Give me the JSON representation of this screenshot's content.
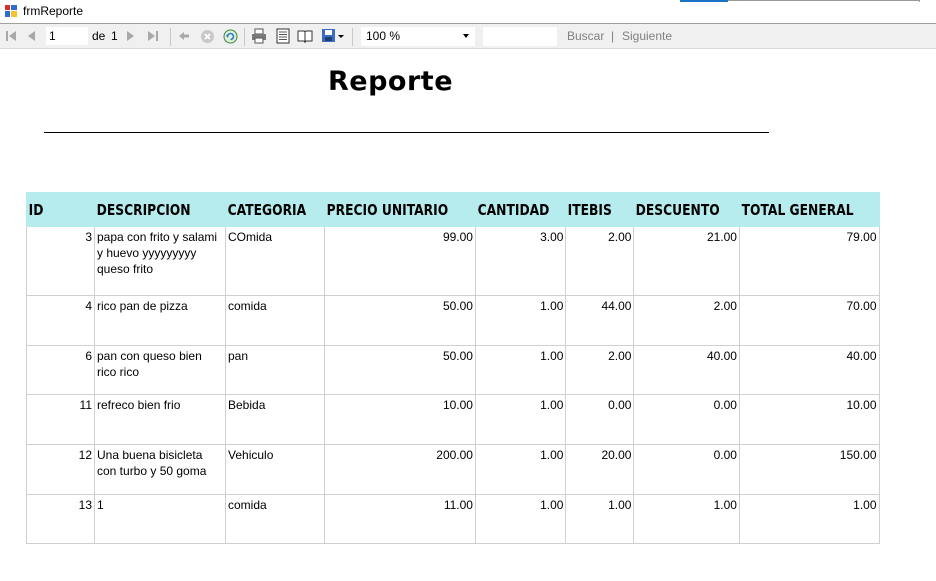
{
  "window": {
    "title": "frmReporte"
  },
  "toolbar": {
    "page_value": "1",
    "of_label": "de",
    "total_pages": "1",
    "zoom_value": "100 %",
    "search_label": "Buscar",
    "separator_label": "|",
    "next_label": "Siguiente"
  },
  "report": {
    "title": "Reporte",
    "columns": [
      "ID",
      "DESCRIPCION",
      "CATEGORIA",
      "PRECIO UNITARIO",
      "CANTIDAD",
      "ITEBIS",
      "DESCUENTO",
      "TOTAL GENERAL"
    ],
    "rows": [
      [
        "3",
        "papa con frito y salami y huevo yyyyyyyyy queso frito",
        "COmida",
        "99.00",
        "3.00",
        "2.00",
        "21.00",
        "79.00"
      ],
      [
        "4",
        "rico  pan de pizza",
        "comida",
        "50.00",
        "1.00",
        "44.00",
        "2.00",
        "70.00"
      ],
      [
        "6",
        "pan con queso bien rico rico",
        "pan",
        "50.00",
        "1.00",
        "2.00",
        "40.00",
        "40.00"
      ],
      [
        "11",
        "refreco bien frio",
        "Bebida",
        "10.00",
        "1.00",
        "0.00",
        "0.00",
        "10.00"
      ],
      [
        "12",
        "Una buena bisicleta con turbo y 50 goma",
        "Vehiculo",
        "200.00",
        "1.00",
        "20.00",
        "0.00",
        "150.00"
      ],
      [
        "13",
        "1",
        "comida",
        "11.00",
        "1.00",
        "1.00",
        "1.00",
        "1.00"
      ]
    ]
  }
}
